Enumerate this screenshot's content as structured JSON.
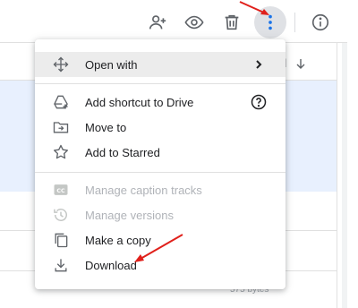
{
  "toolbar": {
    "icons": [
      "add-person-icon",
      "preview-eye-icon",
      "trash-icon",
      "more-vert-icon",
      "info-icon"
    ]
  },
  "list": {
    "sort_column_fragment": "d",
    "size_fragment": "575 bytes"
  },
  "menu": {
    "items": [
      {
        "label": "Open with",
        "icon": "move-arrows-icon",
        "has_submenu": true,
        "highlighted": true
      },
      {
        "label": "Add shortcut to Drive",
        "icon": "drive-shortcut-icon",
        "help": true
      },
      {
        "label": "Move to",
        "icon": "folder-move-icon"
      },
      {
        "label": "Add to Starred",
        "icon": "star-outline-icon"
      },
      {
        "label": "Manage caption tracks",
        "icon": "closed-caption-icon",
        "disabled": true
      },
      {
        "label": "Manage versions",
        "icon": "history-icon",
        "disabled": true
      },
      {
        "label": "Make a copy",
        "icon": "copy-icon"
      },
      {
        "label": "Download",
        "icon": "download-icon"
      }
    ]
  },
  "colors": {
    "accent": "#1a73e8",
    "selection": "#e8f0fe",
    "highlight": "#ececec",
    "annotation": "#e0201b",
    "icon": "#5f6368",
    "disabled": "#b0b3b8"
  }
}
